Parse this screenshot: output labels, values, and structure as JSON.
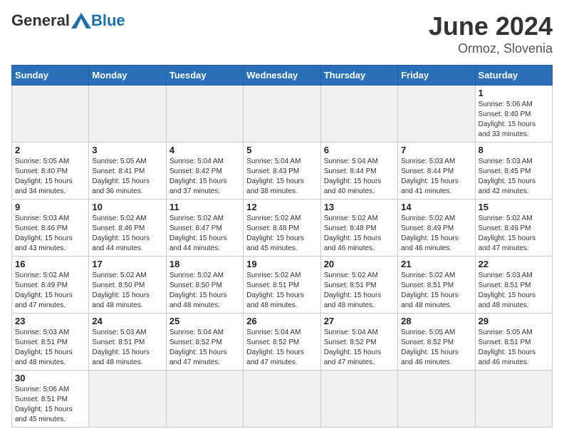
{
  "header": {
    "logo_general": "General",
    "logo_blue": "Blue",
    "month_year": "June 2024",
    "location": "Ormoz, Slovenia"
  },
  "weekdays": [
    "Sunday",
    "Monday",
    "Tuesday",
    "Wednesday",
    "Thursday",
    "Friday",
    "Saturday"
  ],
  "weeks": [
    [
      {
        "day": "",
        "info": ""
      },
      {
        "day": "",
        "info": ""
      },
      {
        "day": "",
        "info": ""
      },
      {
        "day": "",
        "info": ""
      },
      {
        "day": "",
        "info": ""
      },
      {
        "day": "",
        "info": ""
      },
      {
        "day": "1",
        "info": "Sunrise: 5:06 AM\nSunset: 8:40 PM\nDaylight: 15 hours\nand 33 minutes."
      }
    ],
    [
      {
        "day": "2",
        "info": "Sunrise: 5:05 AM\nSunset: 8:40 PM\nDaylight: 15 hours\nand 34 minutes."
      },
      {
        "day": "3",
        "info": "Sunrise: 5:05 AM\nSunset: 8:41 PM\nDaylight: 15 hours\nand 36 minutes."
      },
      {
        "day": "4",
        "info": "Sunrise: 5:04 AM\nSunset: 8:42 PM\nDaylight: 15 hours\nand 37 minutes."
      },
      {
        "day": "5",
        "info": "Sunrise: 5:04 AM\nSunset: 8:43 PM\nDaylight: 15 hours\nand 38 minutes."
      },
      {
        "day": "6",
        "info": "Sunrise: 5:04 AM\nSunset: 8:44 PM\nDaylight: 15 hours\nand 40 minutes."
      },
      {
        "day": "7",
        "info": "Sunrise: 5:03 AM\nSunset: 8:44 PM\nDaylight: 15 hours\nand 41 minutes."
      },
      {
        "day": "8",
        "info": "Sunrise: 5:03 AM\nSunset: 8:45 PM\nDaylight: 15 hours\nand 42 minutes."
      }
    ],
    [
      {
        "day": "9",
        "info": "Sunrise: 5:03 AM\nSunset: 8:46 PM\nDaylight: 15 hours\nand 43 minutes."
      },
      {
        "day": "10",
        "info": "Sunrise: 5:02 AM\nSunset: 8:46 PM\nDaylight: 15 hours\nand 44 minutes."
      },
      {
        "day": "11",
        "info": "Sunrise: 5:02 AM\nSunset: 8:47 PM\nDaylight: 15 hours\nand 44 minutes."
      },
      {
        "day": "12",
        "info": "Sunrise: 5:02 AM\nSunset: 8:48 PM\nDaylight: 15 hours\nand 45 minutes."
      },
      {
        "day": "13",
        "info": "Sunrise: 5:02 AM\nSunset: 8:48 PM\nDaylight: 15 hours\nand 46 minutes."
      },
      {
        "day": "14",
        "info": "Sunrise: 5:02 AM\nSunset: 8:49 PM\nDaylight: 15 hours\nand 46 minutes."
      },
      {
        "day": "15",
        "info": "Sunrise: 5:02 AM\nSunset: 8:49 PM\nDaylight: 15 hours\nand 47 minutes."
      }
    ],
    [
      {
        "day": "16",
        "info": "Sunrise: 5:02 AM\nSunset: 8:49 PM\nDaylight: 15 hours\nand 47 minutes."
      },
      {
        "day": "17",
        "info": "Sunrise: 5:02 AM\nSunset: 8:50 PM\nDaylight: 15 hours\nand 48 minutes."
      },
      {
        "day": "18",
        "info": "Sunrise: 5:02 AM\nSunset: 8:50 PM\nDaylight: 15 hours\nand 48 minutes."
      },
      {
        "day": "19",
        "info": "Sunrise: 5:02 AM\nSunset: 8:51 PM\nDaylight: 15 hours\nand 48 minutes."
      },
      {
        "day": "20",
        "info": "Sunrise: 5:02 AM\nSunset: 8:51 PM\nDaylight: 15 hours\nand 48 minutes."
      },
      {
        "day": "21",
        "info": "Sunrise: 5:02 AM\nSunset: 8:51 PM\nDaylight: 15 hours\nand 48 minutes."
      },
      {
        "day": "22",
        "info": "Sunrise: 5:03 AM\nSunset: 8:51 PM\nDaylight: 15 hours\nand 48 minutes."
      }
    ],
    [
      {
        "day": "23",
        "info": "Sunrise: 5:03 AM\nSunset: 8:51 PM\nDaylight: 15 hours\nand 48 minutes."
      },
      {
        "day": "24",
        "info": "Sunrise: 5:03 AM\nSunset: 8:51 PM\nDaylight: 15 hours\nand 48 minutes."
      },
      {
        "day": "25",
        "info": "Sunrise: 5:04 AM\nSunset: 8:52 PM\nDaylight: 15 hours\nand 47 minutes."
      },
      {
        "day": "26",
        "info": "Sunrise: 5:04 AM\nSunset: 8:52 PM\nDaylight: 15 hours\nand 47 minutes."
      },
      {
        "day": "27",
        "info": "Sunrise: 5:04 AM\nSunset: 8:52 PM\nDaylight: 15 hours\nand 47 minutes."
      },
      {
        "day": "28",
        "info": "Sunrise: 5:05 AM\nSunset: 8:52 PM\nDaylight: 15 hours\nand 46 minutes."
      },
      {
        "day": "29",
        "info": "Sunrise: 5:05 AM\nSunset: 8:51 PM\nDaylight: 15 hours\nand 46 minutes."
      }
    ],
    [
      {
        "day": "30",
        "info": "Sunrise: 5:06 AM\nSunset: 8:51 PM\nDaylight: 15 hours\nand 45 minutes."
      },
      {
        "day": "",
        "info": ""
      },
      {
        "day": "",
        "info": ""
      },
      {
        "day": "",
        "info": ""
      },
      {
        "day": "",
        "info": ""
      },
      {
        "day": "",
        "info": ""
      },
      {
        "day": "",
        "info": ""
      }
    ]
  ]
}
